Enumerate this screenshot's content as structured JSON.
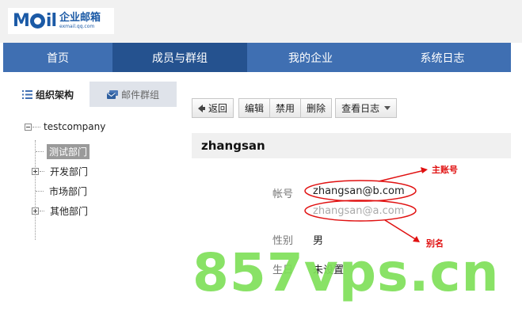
{
  "logo": {
    "mark": "MOil",
    "cn": "企业邮箱",
    "url": "exmail.qq.com"
  },
  "nav": {
    "items": [
      {
        "label": "首页"
      },
      {
        "label": "成员与群组"
      },
      {
        "label": "我的企业"
      },
      {
        "label": "系统日志"
      }
    ],
    "active_index": 1
  },
  "sidebar": {
    "tabs": [
      {
        "label": "组织架构",
        "icon": "list-icon"
      },
      {
        "label": "邮件群组",
        "icon": "mail-group-icon"
      }
    ],
    "tree": {
      "root": "testcompany",
      "nodes": [
        {
          "label": "测试部门",
          "expandable": false,
          "selected": true
        },
        {
          "label": "开发部门",
          "expandable": true,
          "selected": false
        },
        {
          "label": "市场部门",
          "expandable": false,
          "selected": false
        },
        {
          "label": "其他部门",
          "expandable": true,
          "selected": false
        }
      ]
    }
  },
  "toolbar": {
    "back": "返回",
    "edit": "编辑",
    "disable": "禁用",
    "delete": "删除",
    "view_log": "查看日志"
  },
  "member": {
    "name": "zhangsan",
    "account_label": "帐号",
    "account": "zhangsan@b.com",
    "alias": "zhangsan@a.com",
    "gender_label": "性别",
    "gender": "男",
    "birthday_label": "生日",
    "birthday": "未设置"
  },
  "annotations": {
    "primary": "主账号",
    "alias": "别名",
    "color": "#e01010"
  },
  "watermark": "857vps.cn",
  "colors": {
    "nav_bg": "#3f6fb2",
    "nav_active": "#25528f",
    "brand": "#1b5aa6",
    "watermark": "#7fe05a"
  }
}
